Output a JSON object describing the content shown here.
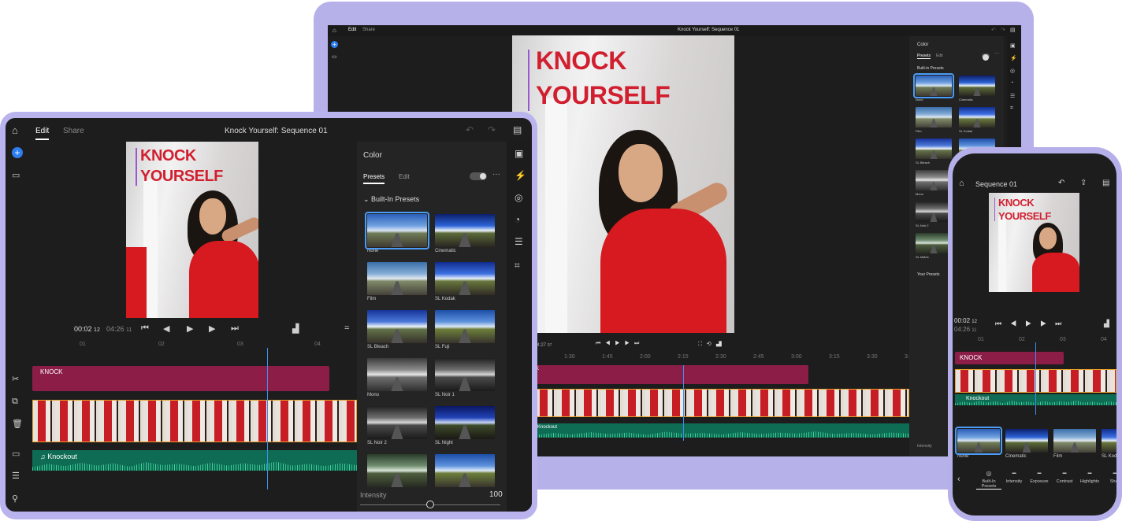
{
  "project_title": "Knock Yourself: Sequence 01",
  "phone_title": "Sequence 01",
  "tabs": {
    "edit": "Edit",
    "share": "Share"
  },
  "overlay_title": {
    "line1": "KNOCK",
    "line2": "YOURSELF"
  },
  "panel": {
    "title": "Color",
    "tab_presets": "Presets",
    "tab_edit": "Edit",
    "section_builtin": "Built-In Presets",
    "section_builtin_laptop": "Built-in Presets",
    "section_your": "Your Presets",
    "intensity_label": "Intensity",
    "intensity_value": "100",
    "intensity_fraction": 1.0
  },
  "tablet_presets": [
    "None",
    "Cinematic",
    "Film",
    "SL Kodak",
    "SL Bleach",
    "SL Fuji",
    "Mono",
    "SL Noir 1",
    "SL Noir 2",
    "SL Night",
    "",
    ""
  ],
  "laptop_presets": [
    "None",
    "Cinematic",
    "Film",
    "SL Kodak",
    "SL Bleach",
    "",
    "Mono",
    "",
    "SL Noir 2",
    "",
    "SL Matrix",
    ""
  ],
  "tablet_timecode": {
    "current": "00:02",
    "current_frames": "12",
    "total": "04:26",
    "total_frames": "11"
  },
  "laptop_timecode": {
    "current": "04:27",
    "current_frames": "07"
  },
  "phone_timecode": {
    "current": "00:02",
    "current_frames": "12",
    "total": "04:26",
    "total_frames": "11"
  },
  "tablet_ruler": [
    "01",
    "02",
    "03",
    "04"
  ],
  "laptop_ruler": [
    "1:30",
    "1:45",
    "2:00",
    "2:15",
    "2:30",
    "2:45",
    "3:00",
    "3:15",
    "3:30",
    "3:4"
  ],
  "phone_ruler": [
    "01",
    "02",
    "03",
    "04"
  ],
  "clip_title": "KNOCK",
  "clip_title_short": "K",
  "audio_clip": "Knockout",
  "audio_clip_laptop": "Knockout",
  "phone_presets": [
    "None",
    "Cinematic",
    "Film",
    "SL Kod"
  ],
  "phone_tools": [
    {
      "label": "Built-In\nPresets"
    },
    {
      "label": "Intensity"
    },
    {
      "label": "Exposure"
    },
    {
      "label": "Contrast"
    },
    {
      "label": "Highlights"
    },
    {
      "label": "Shac"
    }
  ],
  "laptop_intensity_label": "Intensity",
  "colors": {
    "accent": "#3e8ff0",
    "title_red": "#d11f2f",
    "frame_purple": "#b7b1ea",
    "clip_magenta": "#8c1d47",
    "audio_green": "#0f6c54"
  }
}
